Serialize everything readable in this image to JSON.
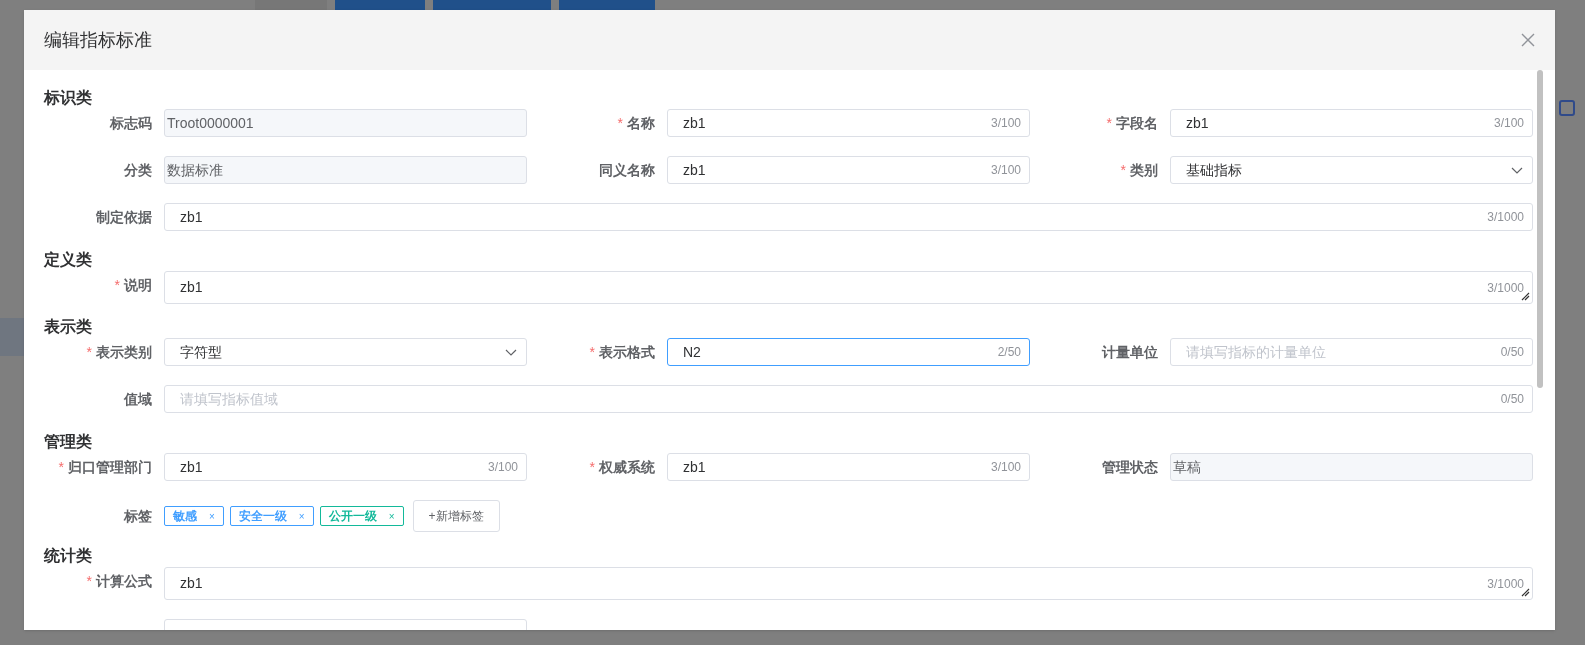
{
  "dialog": {
    "title": "编辑指标标准"
  },
  "sections": [
    {
      "title": "标识类",
      "rows": [
        [
          {
            "kind": "input",
            "label": "标志码",
            "value": "Troot0000001",
            "disabled": true
          },
          {
            "kind": "input",
            "label": "名称",
            "asterisk": "*",
            "value": "zb1",
            "counter": "3/100",
            "disabled": false
          },
          {
            "kind": "input",
            "label": "字段名",
            "asterisk": "*",
            "value": "zb1",
            "counter": "3/100",
            "disabled": false
          }
        ],
        [
          {
            "kind": "input",
            "label": "分类",
            "value": "数据标准",
            "disabled": true
          },
          {
            "kind": "input",
            "label": "同义名称",
            "value": "zb1",
            "counter": "3/100",
            "disabled": false
          },
          {
            "kind": "select",
            "label": "类别",
            "asterisk": "*",
            "value": "基础指标"
          }
        ],
        [
          {
            "kind": "input",
            "label": "制定依据",
            "value": "zb1",
            "counter": "3/1000",
            "disabled": false
          }
        ]
      ]
    },
    {
      "title": "定义类",
      "rows": [
        [
          {
            "kind": "textarea",
            "label": "说明",
            "asterisk": "*",
            "value": "zb1",
            "counter": "3/1000"
          }
        ]
      ]
    },
    {
      "title": "表示类",
      "rows": [
        [
          {
            "kind": "select",
            "label": "表示类别",
            "asterisk": "*",
            "value": "字符型"
          },
          {
            "kind": "input",
            "label": "表示格式",
            "asterisk": "*",
            "value": "N2",
            "counter": "2/50",
            "disabled": false,
            "focused": true
          },
          {
            "kind": "input",
            "label": "计量单位",
            "placeholder": "请填写指标的计量单位",
            "counter": "0/50",
            "disabled": false
          }
        ],
        [
          {
            "kind": "input",
            "label": "值域",
            "placeholder": "请填写指标值域",
            "counter": "0/50",
            "disabled": false
          }
        ]
      ]
    },
    {
      "title": "管理类",
      "rows": [
        [
          {
            "kind": "input",
            "label": "归口管理部门",
            "asterisk": "*",
            "value": "zb1",
            "counter": "3/100",
            "disabled": false
          },
          {
            "kind": "input",
            "label": "权威系统",
            "asterisk": "*",
            "value": "zb1",
            "counter": "3/100",
            "disabled": false
          },
          {
            "kind": "input",
            "label": "管理状态",
            "value": "草稿",
            "disabled": true
          }
        ],
        [
          {
            "kind": "tags",
            "label": "标签",
            "tags": [
              {
                "text": "敏感",
                "close": "×",
                "color": "#409eff"
              },
              {
                "text": "安全一级",
                "close": "×",
                "color": "#409eff"
              },
              {
                "text": "公开一级",
                "close": "×",
                "color": "#13b99a"
              }
            ],
            "add_button": "+新增标签"
          }
        ]
      ]
    },
    {
      "title": "统计类",
      "rows": [
        [
          {
            "kind": "textarea",
            "label": "计算公式",
            "asterisk": "*",
            "value": "zb1",
            "counter": "3/1000"
          }
        ],
        [
          {
            "kind": "partial"
          }
        ]
      ]
    }
  ]
}
